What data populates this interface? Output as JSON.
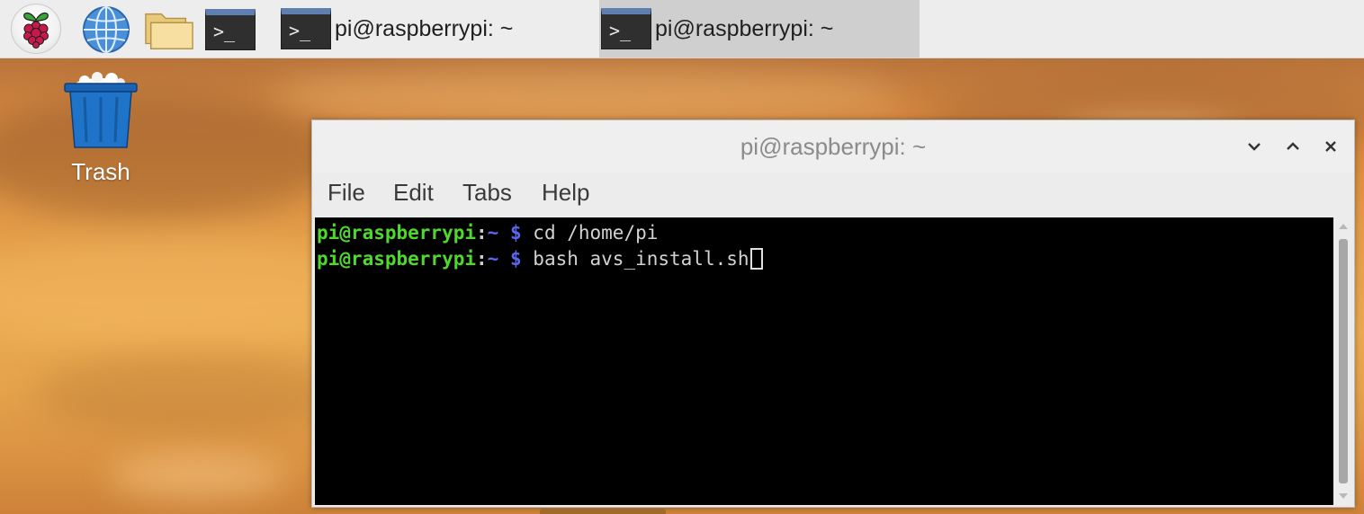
{
  "taskbar": {
    "menu_icon": "raspberry-pi-logo-icon",
    "browser_icon": "globe-icon",
    "files_icon": "folder-icon",
    "terminal_icon": "terminal-icon",
    "terminal_glyph": ">_",
    "tasks": [
      {
        "label": "pi@raspberrypi: ~",
        "active": false
      },
      {
        "label": "pi@raspberrypi: ~",
        "active": true
      }
    ]
  },
  "desktop": {
    "trash": {
      "label": "Trash",
      "icon": "trash-icon",
      "color": "#1e6dc0"
    }
  },
  "window": {
    "title": "pi@raspberrypi: ~",
    "controls": [
      "minimize",
      "maximize",
      "close"
    ],
    "menu": [
      "File",
      "Edit",
      "Tabs",
      "Help"
    ],
    "terminal": {
      "lines": [
        {
          "user": "pi@raspberrypi",
          "colon": ":",
          "path": "~",
          "dollar": "$",
          "command": "cd /home/pi"
        },
        {
          "user": "pi@raspberrypi",
          "colon": ":",
          "path": "~",
          "dollar": "$",
          "command": "bash avs_install.sh"
        }
      ]
    }
  },
  "colors": {
    "prompt_user": "#4fd82e",
    "prompt_path": "#5a67f0",
    "terminal_bg": "#000000",
    "taskbar_bg": "#ededed",
    "active_task_bg": "#cfcfcf"
  }
}
